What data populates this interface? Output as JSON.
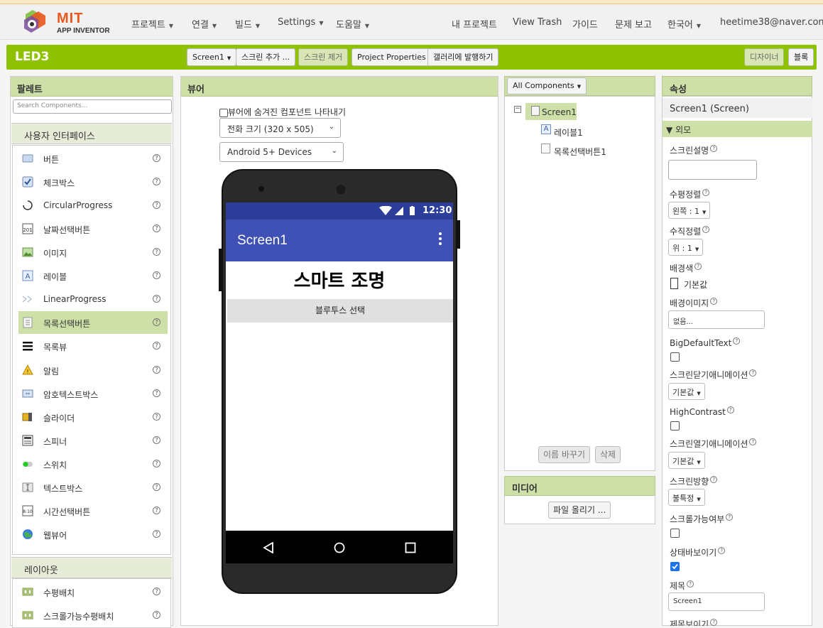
{
  "nav": {
    "logo_mit": "MIT",
    "logo_sub": "APP INVENTOR",
    "projects": "프로젝트",
    "connect": "연결",
    "build": "빌드",
    "settings": "Settings",
    "help": "도움말",
    "my_projects": "내 프로젝트",
    "view_trash": "View Trash",
    "guide": "가이드",
    "report": "문제 보고",
    "language": "한국어",
    "account": "heetime38@naver.com"
  },
  "toolbar": {
    "project_name": "LED3",
    "screen_select": "Screen1",
    "add_screen": "스크린 추가 ...",
    "remove_screen": "스크린 제거",
    "project_properties": "Project Properties",
    "publish_gallery": "갤러리에 발행하기",
    "designer": "디자이너",
    "blocks": "블록"
  },
  "palette": {
    "title": "팔레트",
    "search_placeholder": "Search Components...",
    "category_ui": "사용자 인터페이스",
    "items": [
      {
        "label": "버튼",
        "icon": "button-icon"
      },
      {
        "label": "체크박스",
        "icon": "checkbox-icon"
      },
      {
        "label": "CircularProgress",
        "icon": "circular-progress-icon"
      },
      {
        "label": "날짜선택버튼",
        "icon": "date-picker-icon"
      },
      {
        "label": "이미지",
        "icon": "image-icon"
      },
      {
        "label": "레이블",
        "icon": "label-icon"
      },
      {
        "label": "LinearProgress",
        "icon": "linear-progress-icon"
      },
      {
        "label": "목록선택버튼",
        "icon": "list-picker-icon"
      },
      {
        "label": "목록뷰",
        "icon": "list-view-icon"
      },
      {
        "label": "알림",
        "icon": "notifier-icon"
      },
      {
        "label": "암호텍스트박스",
        "icon": "password-textbox-icon"
      },
      {
        "label": "슬라이더",
        "icon": "slider-icon"
      },
      {
        "label": "스피너",
        "icon": "spinner-icon"
      },
      {
        "label": "스위치",
        "icon": "switch-icon"
      },
      {
        "label": "텍스트박스",
        "icon": "textbox-icon"
      },
      {
        "label": "시간선택버튼",
        "icon": "time-picker-icon"
      },
      {
        "label": "웹뷰어",
        "icon": "web-viewer-icon"
      }
    ],
    "category_layout": "레이아웃",
    "layout_items": [
      {
        "label": "수평배치",
        "icon": "horizontal-arrangement-icon"
      },
      {
        "label": "스크롤가능수평배치",
        "icon": "horizontal-scroll-arrangement-icon"
      }
    ]
  },
  "viewer": {
    "title": "뷰어",
    "show_hidden": "뷰어에 숨겨진 컴포넌트 나타내기",
    "size_select": "전화 크기 (320 x 505)",
    "device_select": "Android 5+ Devices",
    "status_time": "12:30",
    "screen_title": "Screen1",
    "label_text": "스마트 조명",
    "listpicker_text": "블루투스 선택"
  },
  "components": {
    "dropdown": "All Components",
    "root": "Screen1",
    "children": [
      "레이블1",
      "목록선택버튼1"
    ],
    "rename": "이름 바꾸기",
    "delete": "삭제",
    "media_title": "미디어",
    "upload": "파일 올리기 ..."
  },
  "properties": {
    "title": "속성",
    "subject": "Screen1 (Screen)",
    "section": "외모",
    "about_screen": "스크린설명",
    "align_h": "수평정렬",
    "align_h_value": "왼쪽 : 1",
    "align_v": "수직정렬",
    "align_v_value": "위 : 1",
    "bg_color": "배경색",
    "bg_color_value": "기본값",
    "bg_image": "배경이미지",
    "bg_image_value": "없음...",
    "big_text": "BigDefaultText",
    "close_anim": "스크린닫기애니메이션",
    "close_anim_value": "기본값",
    "high_contrast": "HighContrast",
    "open_anim": "스크린열기애니메이션",
    "open_anim_value": "기본값",
    "orientation": "스크린방향",
    "orientation_value": "불특정",
    "scrollable": "스크롤가능여부",
    "show_status": "상태바보이기",
    "title_label": "제목",
    "title_value": "Screen1",
    "title_visible": "제목보이기"
  },
  "colors": {
    "brand_green": "#8fc202",
    "header_green": "#cfdfa8",
    "app_bar": "#3f51b5",
    "status_bar": "#2c3e99"
  }
}
